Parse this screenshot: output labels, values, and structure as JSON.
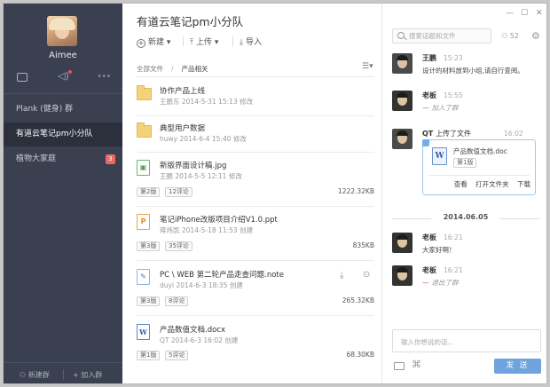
{
  "sidebar": {
    "user_name": "Aimee",
    "items": [
      {
        "label": "Plank (健身) 群"
      },
      {
        "label": "有道云笔记pm小分队"
      },
      {
        "label": "植物大家庭",
        "badge": "3"
      }
    ],
    "footer": {
      "new_group": "新建群",
      "join_group": "加入群"
    }
  },
  "center": {
    "title": "有道云笔记pm小分队",
    "toolbar": {
      "new_label": "新建",
      "upload_label": "上传",
      "import_label": "导入"
    },
    "breadcrumb": {
      "root": "全部文件",
      "current": "产品相关"
    },
    "files": [
      {
        "name": "协作产品上线",
        "author": "王鹏东",
        "date": "2014-5-31 15:13",
        "action": "修改"
      },
      {
        "name": "典型用户数据",
        "author": "huwy",
        "date": "2014-6-4 15:40",
        "action": "修改"
      },
      {
        "name": "新版界面设计稿.jpg",
        "author": "王鹏",
        "date": "2014-5-5 12:11",
        "action": "修改",
        "version": "第2版",
        "comments": "12评论",
        "size": "1222.32KB"
      },
      {
        "name": "笔记iPhone改版项目介绍V1.0.ppt",
        "author": "蒋炜凯",
        "date": "2014-5-18 11:53",
        "action": "创建",
        "version": "第3版",
        "comments": "35评论",
        "size": "835KB"
      },
      {
        "name": "PC \\ WEB 第二轮产品走查问题.note",
        "author": "duyi",
        "date": "2014-6-3 18:35",
        "action": "创建",
        "version": "第3版",
        "comments": "8评论",
        "size": "265.32KB"
      },
      {
        "name": "产品数值文档.docx",
        "author": "QT",
        "date": "2014-6-3 16:02",
        "action": "创建",
        "version": "第1版",
        "comments": "5评论",
        "size": "68.30KB"
      }
    ]
  },
  "chat": {
    "search_placeholder": "搜索话题和文件",
    "member_count": "52",
    "messages": [
      {
        "name": "王鹏",
        "time": "15:23",
        "text": "设计的材料放到小组,请自行查阅。"
      },
      {
        "name": "老板",
        "time": "15:55",
        "event": "加入了群"
      },
      {
        "name": "QT",
        "title": "上传了文件",
        "time": "16:02",
        "file_name": "产品数值文档.doc",
        "file_version": "第1版",
        "actions": [
          "查看",
          "打开文件夹",
          "下载"
        ]
      },
      {
        "name": "老板",
        "time": "16:21",
        "text": "大家好啊！"
      },
      {
        "name": "老板",
        "time": "16:21",
        "event": "退出了群"
      }
    ],
    "date_separator": "2014.06.05",
    "input_placeholder": "输入你想说的话...",
    "send_label": "发 送"
  }
}
